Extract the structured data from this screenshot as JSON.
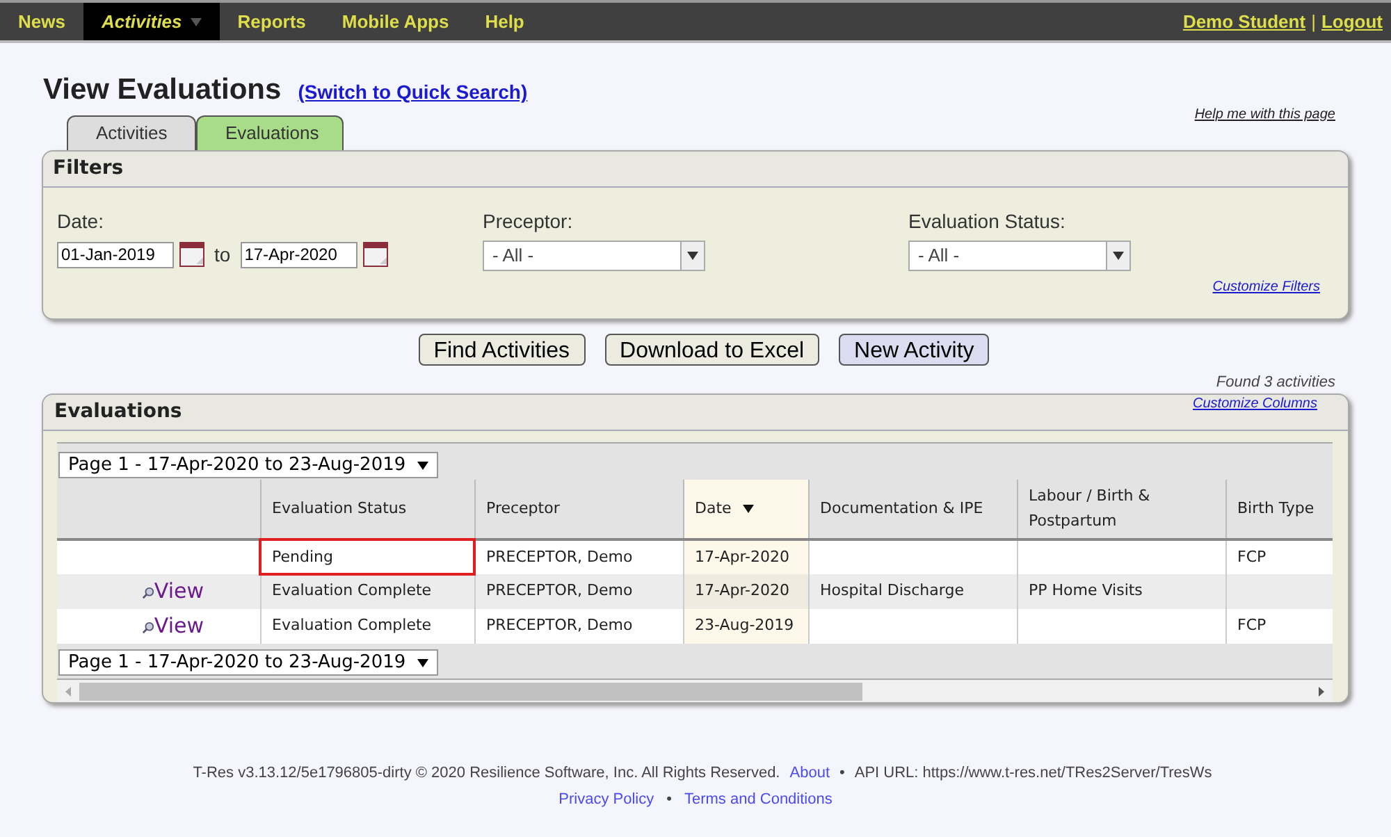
{
  "nav": {
    "items": [
      {
        "label": "News",
        "selected": false,
        "dropdown": false
      },
      {
        "label": "Activities",
        "selected": true,
        "dropdown": true
      },
      {
        "label": "Reports",
        "selected": false,
        "dropdown": false
      },
      {
        "label": "Mobile Apps",
        "selected": false,
        "dropdown": false
      },
      {
        "label": "Help",
        "selected": false,
        "dropdown": false
      }
    ],
    "user": "Demo Student",
    "separator": "|",
    "logout": "Logout"
  },
  "page": {
    "title": "View Evaluations",
    "switch_link": "(Switch to Quick Search)",
    "help_link": "Help me with this page"
  },
  "tabs": [
    {
      "label": "Activities",
      "selected": false
    },
    {
      "label": "Evaluations",
      "selected": true
    }
  ],
  "filters": {
    "title": "Filters",
    "date_label": "Date:",
    "date_from": "01-Jan-2019",
    "to": "to",
    "date_to": "17-Apr-2020",
    "preceptor_label": "Preceptor:",
    "preceptor_value": "- All -",
    "status_label": "Evaluation Status:",
    "status_value": "- All -",
    "customize": "Customize Filters"
  },
  "buttons": [
    {
      "label": "Find Activities",
      "primary": false
    },
    {
      "label": "Download to Excel",
      "primary": false
    },
    {
      "label": "New Activity",
      "primary": true
    }
  ],
  "found": "Found 3 activities",
  "evaluations": {
    "title": "Evaluations",
    "customize": "Customize Columns",
    "pager_top": "Page 1 - 17-Apr-2020 to 23-Aug-2019",
    "pager_bottom": "Page 1 - 17-Apr-2020 to 23-Aug-2019",
    "columns": [
      {
        "sorted": false
      },
      {
        "label": "Evaluation Status",
        "sorted": false
      },
      {
        "label": "Preceptor",
        "sorted": false
      },
      {
        "label": "Date",
        "sorted": true
      },
      {
        "label": "Documentation & IPE",
        "sorted": false
      },
      {
        "label": "Labour / Birth & Postpartum",
        "sorted": false
      },
      {
        "label": "Birth Type",
        "sorted": false
      }
    ],
    "rows": [
      {
        "cells": [
          "",
          "Pending",
          "PRECEPTOR, Demo",
          "17-Apr-2020",
          "",
          "",
          "FCP"
        ],
        "highlighted": true
      },
      {
        "cells": [
          "View",
          "Evaluation Complete",
          "PRECEPTOR, Demo",
          "17-Apr-2020",
          "Hospital Discharge",
          "PP Home Visits",
          ""
        ],
        "highlighted": false
      },
      {
        "cells": [
          "View",
          "Evaluation Complete",
          "PRECEPTOR, Demo",
          "23-Aug-2019",
          "",
          "",
          "FCP"
        ],
        "highlighted": false
      }
    ]
  },
  "footer": {
    "line1": "T-Res v3.13.12/5e1796805-dirty © 2020 Resilience Software, Inc. All Rights Reserved.",
    "about": "About",
    "bullet1": "•",
    "api": "API URL: https://www.t-res.net/TRes2Server/TresWs",
    "privacy": "Privacy Policy",
    "bullet2": "•",
    "terms": "Terms and Conditions"
  }
}
